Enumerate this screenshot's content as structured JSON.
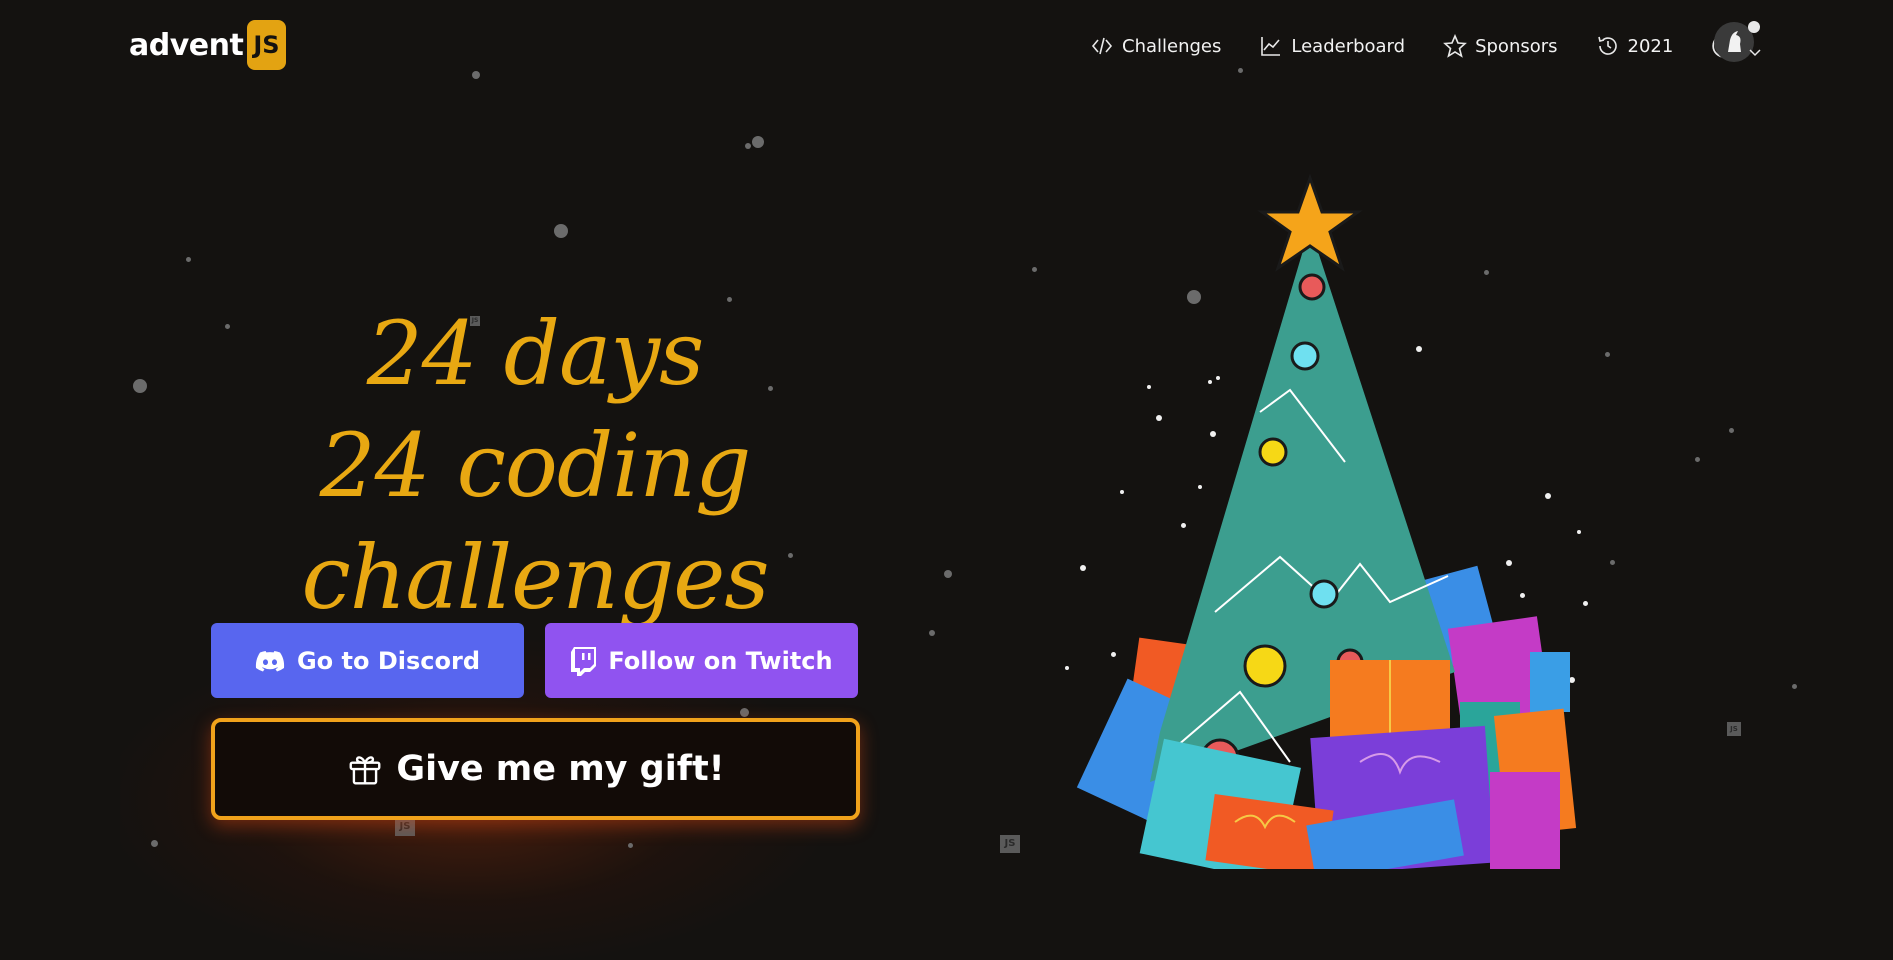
{
  "header": {
    "logo_text": "advent",
    "logo_badge": "JS",
    "nav": [
      {
        "label": "Challenges",
        "icon": "code-icon"
      },
      {
        "label": "Leaderboard",
        "icon": "chart-line-icon"
      },
      {
        "label": "Sponsors",
        "icon": "star-icon"
      },
      {
        "label": "2021",
        "icon": "history-clock-icon"
      }
    ],
    "help_icon": "help-icon",
    "avatar_icon": "user-avatar"
  },
  "hero": {
    "line1": "24 days",
    "line2": "24 coding challenges"
  },
  "buttons": {
    "discord": "Go to Discord",
    "twitch": "Follow on Twitch",
    "gift": "Give me my gift!"
  },
  "colors": {
    "background": "#141210",
    "accent": "#e8a812",
    "discord": "#5866ef",
    "twitch": "#9053f0",
    "gift_border": "#f0a21b"
  }
}
